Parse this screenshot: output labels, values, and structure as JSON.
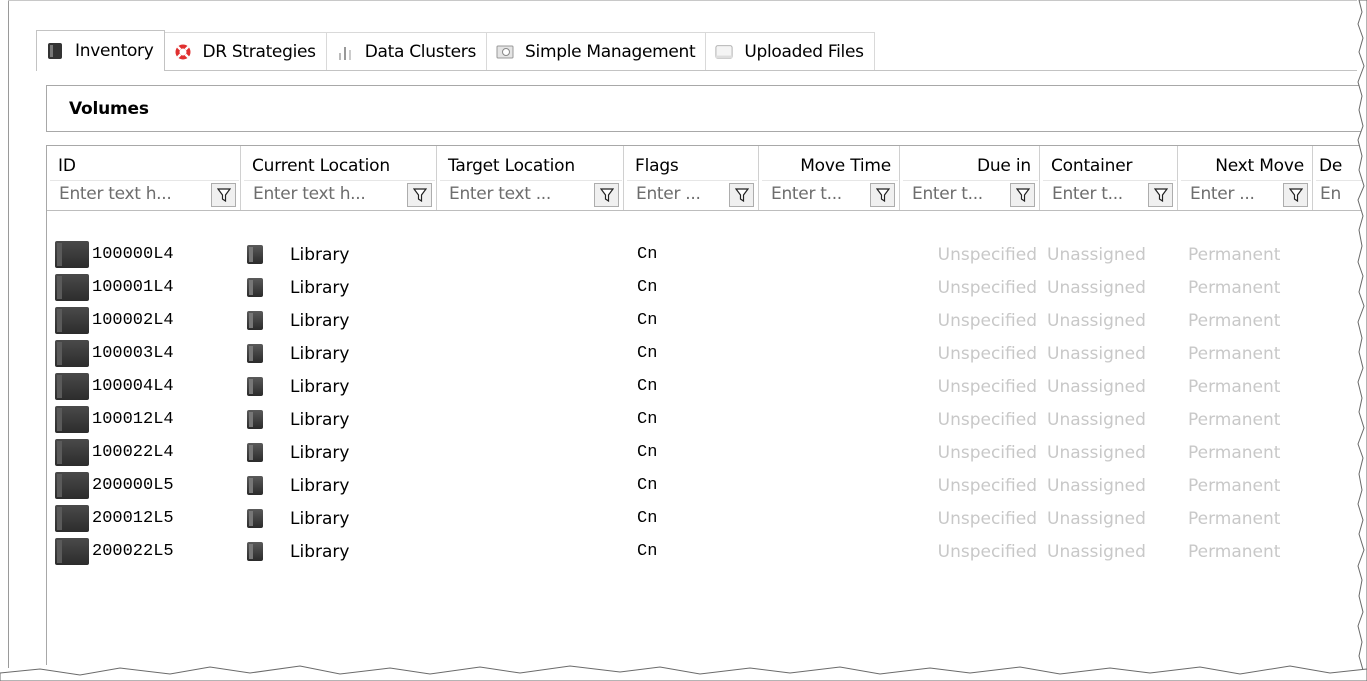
{
  "tabs": [
    {
      "label": "Inventory",
      "icon": "library-icon",
      "active": true
    },
    {
      "label": "DR Strategies",
      "icon": "lifebuoy-icon",
      "active": false
    },
    {
      "label": "Data Clusters",
      "icon": "bar-chart-icon",
      "active": false
    },
    {
      "label": "Simple Management",
      "icon": "management-icon",
      "active": false
    },
    {
      "label": "Uploaded Files",
      "icon": "files-icon",
      "active": false
    }
  ],
  "panel": {
    "title": "Volumes"
  },
  "columns": [
    {
      "title": "ID",
      "placeholder": "Enter text h..."
    },
    {
      "title": "Current Location",
      "placeholder": "Enter text h..."
    },
    {
      "title": "Target Location",
      "placeholder": "Enter text ..."
    },
    {
      "title": "Flags",
      "placeholder": "Enter ..."
    },
    {
      "title": "Move Time",
      "placeholder": "Enter t..."
    },
    {
      "title": "Due in",
      "placeholder": "Enter t..."
    },
    {
      "title": "Container",
      "placeholder": "Enter t..."
    },
    {
      "title": "Next Move",
      "placeholder": "Enter ..."
    },
    {
      "title": "De",
      "placeholder": "En"
    }
  ],
  "rows": [
    {
      "id": "100000L4",
      "current_location": "Library",
      "target_location": "",
      "flags": "Cn",
      "move_time": "",
      "due_in": "Unspecified",
      "container": "Unassigned",
      "next_move": "Permanent"
    },
    {
      "id": "100001L4",
      "current_location": "Library",
      "target_location": "",
      "flags": "Cn",
      "move_time": "",
      "due_in": "Unspecified",
      "container": "Unassigned",
      "next_move": "Permanent"
    },
    {
      "id": "100002L4",
      "current_location": "Library",
      "target_location": "",
      "flags": "Cn",
      "move_time": "",
      "due_in": "Unspecified",
      "container": "Unassigned",
      "next_move": "Permanent"
    },
    {
      "id": "100003L4",
      "current_location": "Library",
      "target_location": "",
      "flags": "Cn",
      "move_time": "",
      "due_in": "Unspecified",
      "container": "Unassigned",
      "next_move": "Permanent"
    },
    {
      "id": "100004L4",
      "current_location": "Library",
      "target_location": "",
      "flags": "Cn",
      "move_time": "",
      "due_in": "Unspecified",
      "container": "Unassigned",
      "next_move": "Permanent"
    },
    {
      "id": "100012L4",
      "current_location": "Library",
      "target_location": "",
      "flags": "Cn",
      "move_time": "",
      "due_in": "Unspecified",
      "container": "Unassigned",
      "next_move": "Permanent"
    },
    {
      "id": "100022L4",
      "current_location": "Library",
      "target_location": "",
      "flags": "Cn",
      "move_time": "",
      "due_in": "Unspecified",
      "container": "Unassigned",
      "next_move": "Permanent"
    },
    {
      "id": "200000L5",
      "current_location": "Library",
      "target_location": "",
      "flags": "Cn",
      "move_time": "",
      "due_in": "Unspecified",
      "container": "Unassigned",
      "next_move": "Permanent"
    },
    {
      "id": "200012L5",
      "current_location": "Library",
      "target_location": "",
      "flags": "Cn",
      "move_time": "",
      "due_in": "Unspecified",
      "container": "Unassigned",
      "next_move": "Permanent"
    },
    {
      "id": "200022L5",
      "current_location": "Library",
      "target_location": "",
      "flags": "Cn",
      "move_time": "",
      "due_in": "Unspecified",
      "container": "Unassigned",
      "next_move": "Permanent"
    }
  ],
  "colors": {
    "dim_text": "#c8c8c8",
    "border": "#a8a8a8",
    "filter_button_bg": "#f0f0f0"
  }
}
